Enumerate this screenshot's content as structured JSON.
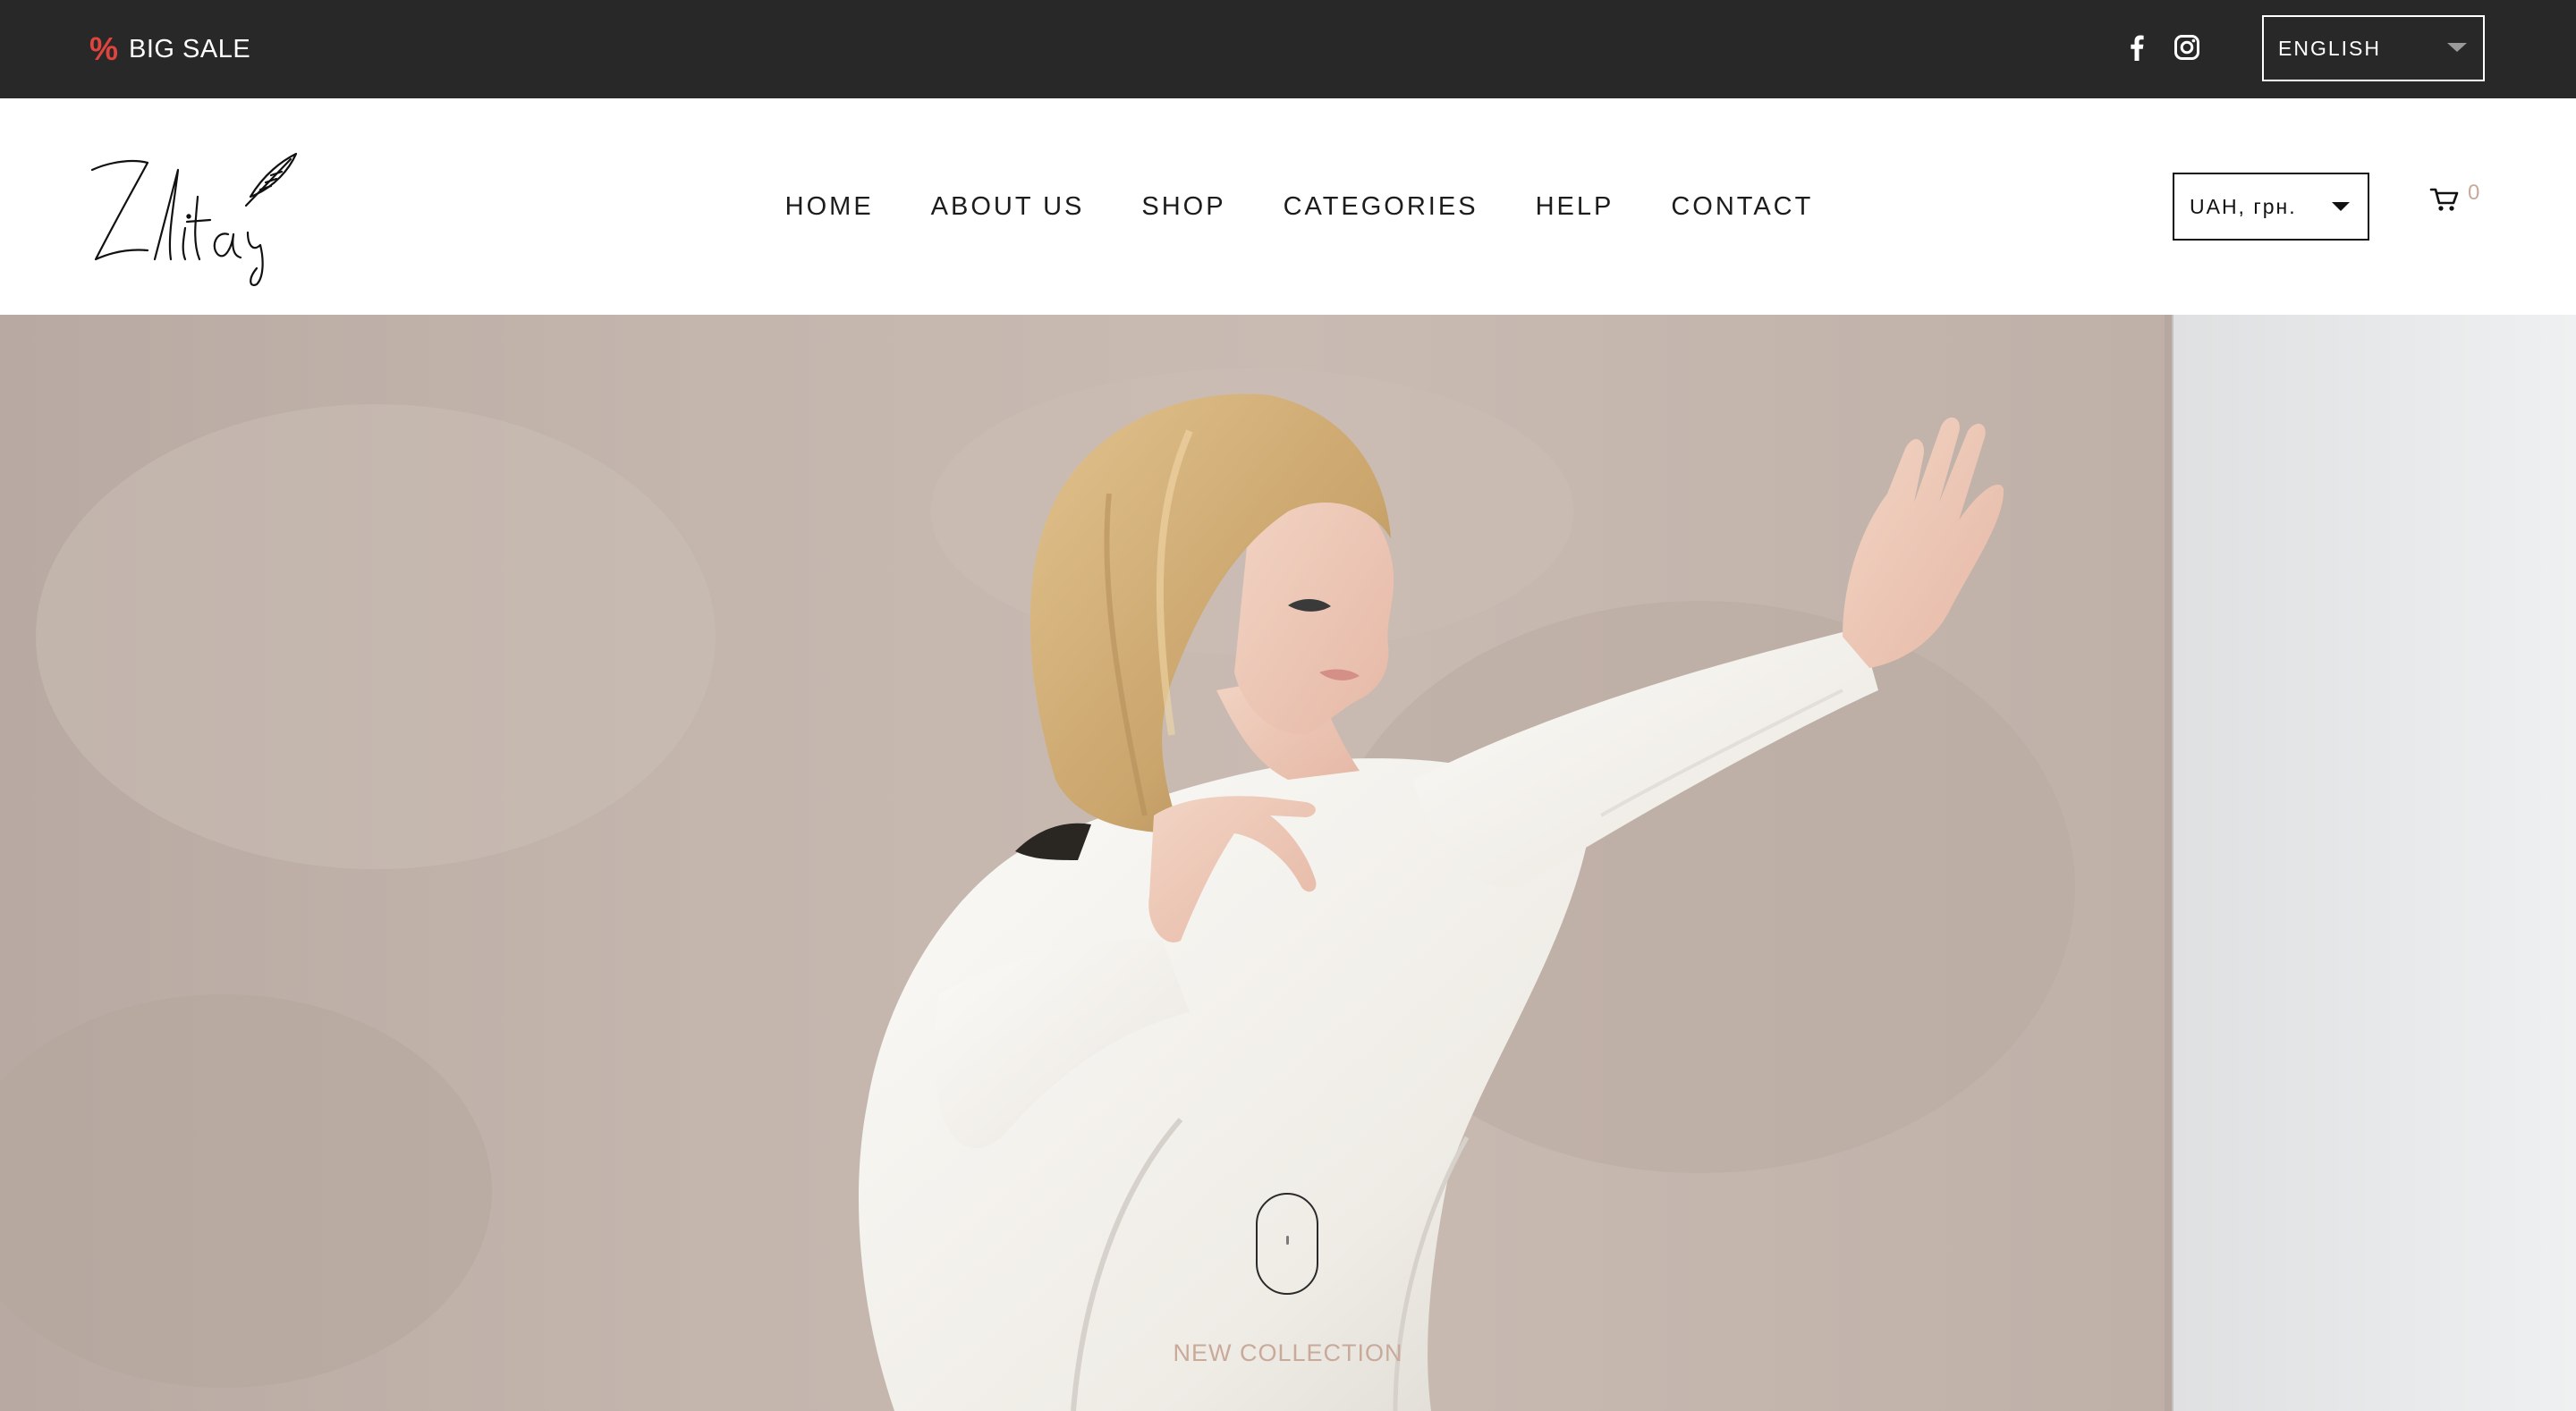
{
  "topbar": {
    "promo_icon": "%",
    "promo_label": "BIG SALE",
    "social": [
      {
        "icon": "facebook-icon"
      },
      {
        "icon": "instagram-icon"
      }
    ],
    "language": {
      "selected": "ENGLISH"
    }
  },
  "header": {
    "logo_text": "Zlitay",
    "nav": [
      {
        "label": "HOME"
      },
      {
        "label": "ABOUT US"
      },
      {
        "label": "SHOP"
      },
      {
        "label": "CATEGORIES"
      },
      {
        "label": "HELP"
      },
      {
        "label": "CONTACT"
      }
    ],
    "currency": {
      "selected": "UAH, грн."
    },
    "cart": {
      "icon": "cart-icon",
      "count": "0"
    }
  },
  "hero": {
    "caption": "NEW COLLECTION",
    "image_subject": "model in white sweatshirt leaning on beige wall"
  },
  "colors": {
    "topbar_bg": "#282828",
    "accent_red": "#e0443e",
    "caption_tint": "#c9a99a",
    "wall_beige": "#c3b5ac"
  }
}
